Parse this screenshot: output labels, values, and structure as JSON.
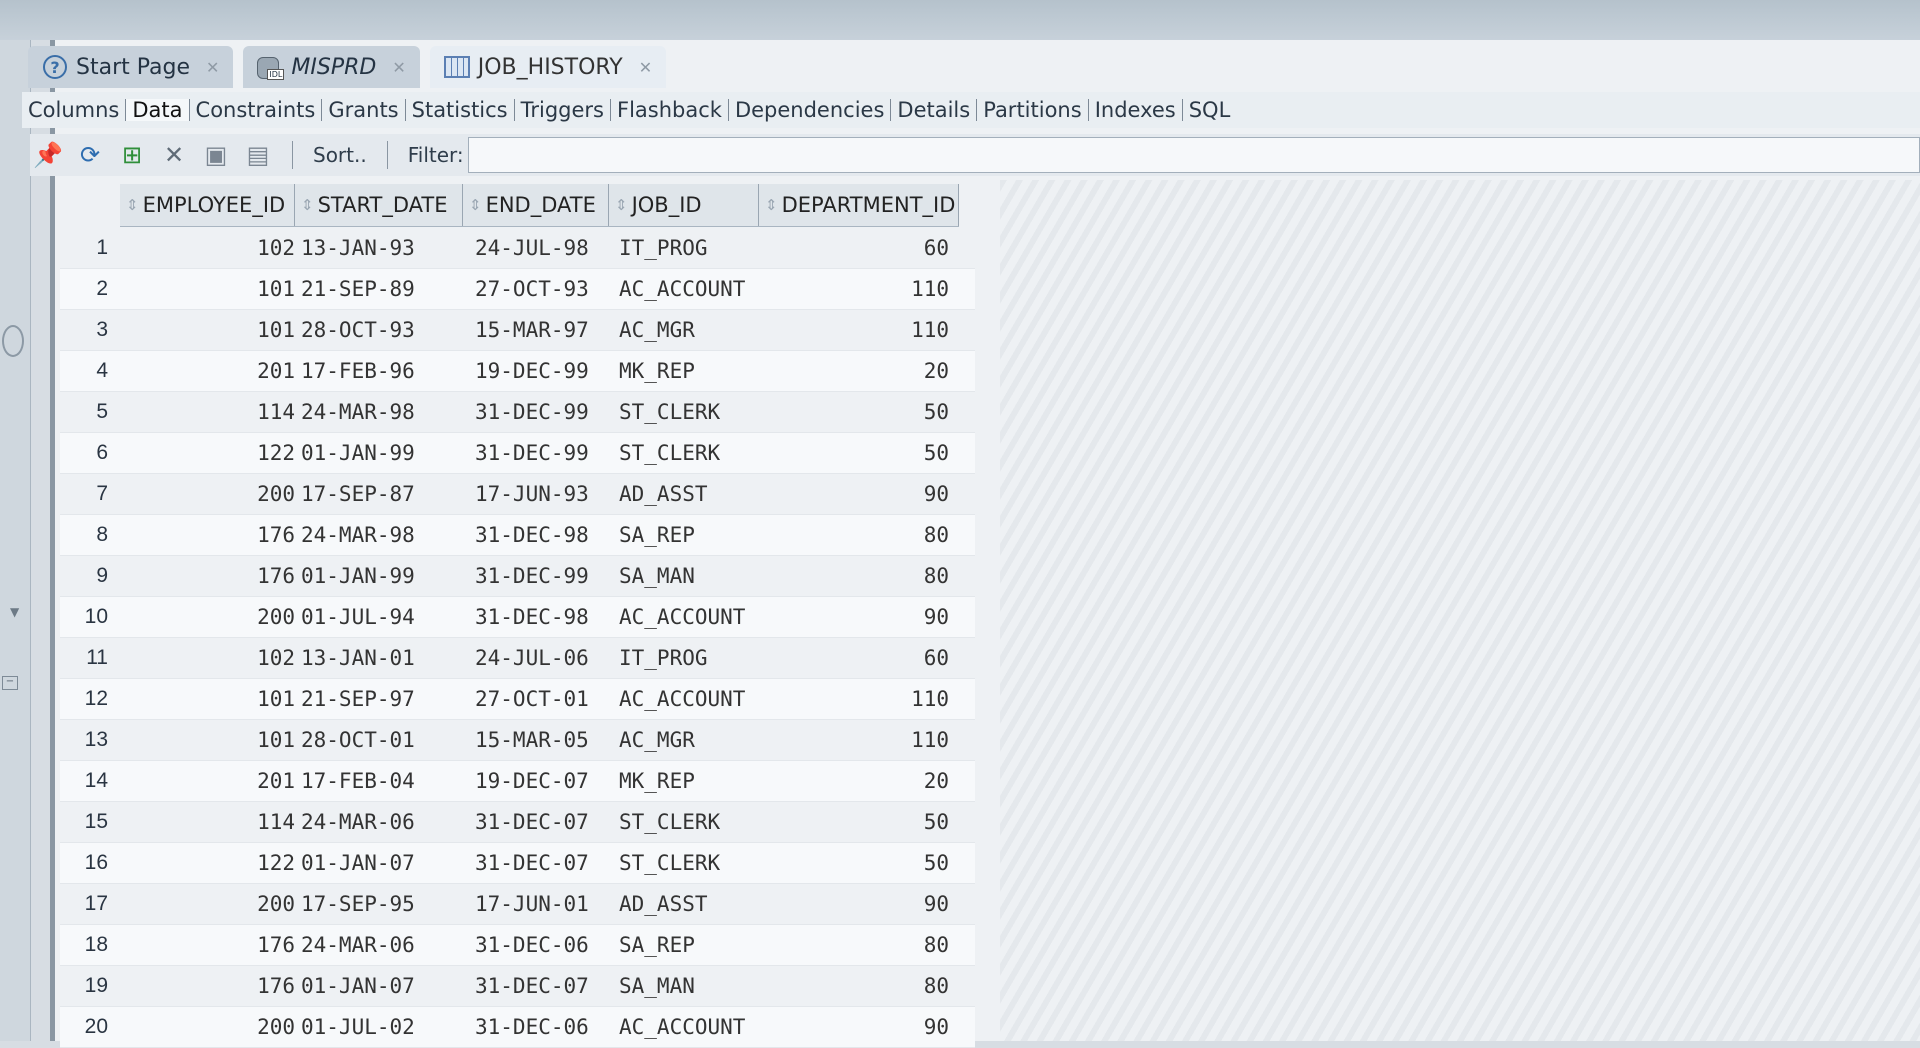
{
  "tabs": [
    {
      "label": "Start Page",
      "icon": "help-circle-icon",
      "active": false
    },
    {
      "label": "MISPRD",
      "icon": "database-icon",
      "icon_tag": "IDL",
      "active": false
    },
    {
      "label": "JOB_HISTORY",
      "icon": "table-grid-icon",
      "active": true
    }
  ],
  "subtabs": [
    "Columns",
    "Data",
    "Constraints",
    "Grants",
    "Statistics",
    "Triggers",
    "Flashback",
    "Dependencies",
    "Details",
    "Partitions",
    "Indexes",
    "SQL"
  ],
  "active_subtab": "Data",
  "toolbar": {
    "icons": [
      "pin-icon",
      "refresh-icon",
      "insert-row-icon",
      "delete-row-icon",
      "commit-icon",
      "rollback-icon"
    ],
    "sort_label": "Sort..",
    "filter_label": "Filter:",
    "filter_value": ""
  },
  "table": {
    "columns": [
      "EMPLOYEE_ID",
      "START_DATE",
      "END_DATE",
      "JOB_ID",
      "DEPARTMENT_ID"
    ],
    "rows": [
      {
        "n": "1",
        "emp": "102",
        "start": "13-JAN-93",
        "end": "24-JUL-98",
        "job": "IT_PROG",
        "dept": "60"
      },
      {
        "n": "2",
        "emp": "101",
        "start": "21-SEP-89",
        "end": "27-OCT-93",
        "job": "AC_ACCOUNT",
        "dept": "110"
      },
      {
        "n": "3",
        "emp": "101",
        "start": "28-OCT-93",
        "end": "15-MAR-97",
        "job": "AC_MGR",
        "dept": "110"
      },
      {
        "n": "4",
        "emp": "201",
        "start": "17-FEB-96",
        "end": "19-DEC-99",
        "job": "MK_REP",
        "dept": "20"
      },
      {
        "n": "5",
        "emp": "114",
        "start": "24-MAR-98",
        "end": "31-DEC-99",
        "job": "ST_CLERK",
        "dept": "50"
      },
      {
        "n": "6",
        "emp": "122",
        "start": "01-JAN-99",
        "end": "31-DEC-99",
        "job": "ST_CLERK",
        "dept": "50"
      },
      {
        "n": "7",
        "emp": "200",
        "start": "17-SEP-87",
        "end": "17-JUN-93",
        "job": "AD_ASST",
        "dept": "90"
      },
      {
        "n": "8",
        "emp": "176",
        "start": "24-MAR-98",
        "end": "31-DEC-98",
        "job": "SA_REP",
        "dept": "80"
      },
      {
        "n": "9",
        "emp": "176",
        "start": "01-JAN-99",
        "end": "31-DEC-99",
        "job": "SA_MAN",
        "dept": "80"
      },
      {
        "n": "10",
        "emp": "200",
        "start": "01-JUL-94",
        "end": "31-DEC-98",
        "job": "AC_ACCOUNT",
        "dept": "90"
      },
      {
        "n": "11",
        "emp": "102",
        "start": "13-JAN-01",
        "end": "24-JUL-06",
        "job": "IT_PROG",
        "dept": "60"
      },
      {
        "n": "12",
        "emp": "101",
        "start": "21-SEP-97",
        "end": "27-OCT-01",
        "job": "AC_ACCOUNT",
        "dept": "110"
      },
      {
        "n": "13",
        "emp": "101",
        "start": "28-OCT-01",
        "end": "15-MAR-05",
        "job": "AC_MGR",
        "dept": "110"
      },
      {
        "n": "14",
        "emp": "201",
        "start": "17-FEB-04",
        "end": "19-DEC-07",
        "job": "MK_REP",
        "dept": "20"
      },
      {
        "n": "15",
        "emp": "114",
        "start": "24-MAR-06",
        "end": "31-DEC-07",
        "job": "ST_CLERK",
        "dept": "50"
      },
      {
        "n": "16",
        "emp": "122",
        "start": "01-JAN-07",
        "end": "31-DEC-07",
        "job": "ST_CLERK",
        "dept": "50"
      },
      {
        "n": "17",
        "emp": "200",
        "start": "17-SEP-95",
        "end": "17-JUN-01",
        "job": "AD_ASST",
        "dept": "90"
      },
      {
        "n": "18",
        "emp": "176",
        "start": "24-MAR-06",
        "end": "31-DEC-06",
        "job": "SA_REP",
        "dept": "80"
      },
      {
        "n": "19",
        "emp": "176",
        "start": "01-JAN-07",
        "end": "31-DEC-07",
        "job": "SA_MAN",
        "dept": "80"
      },
      {
        "n": "20",
        "emp": "200",
        "start": "01-JUL-02",
        "end": "31-DEC-06",
        "job": "AC_ACCOUNT",
        "dept": "90"
      }
    ]
  }
}
